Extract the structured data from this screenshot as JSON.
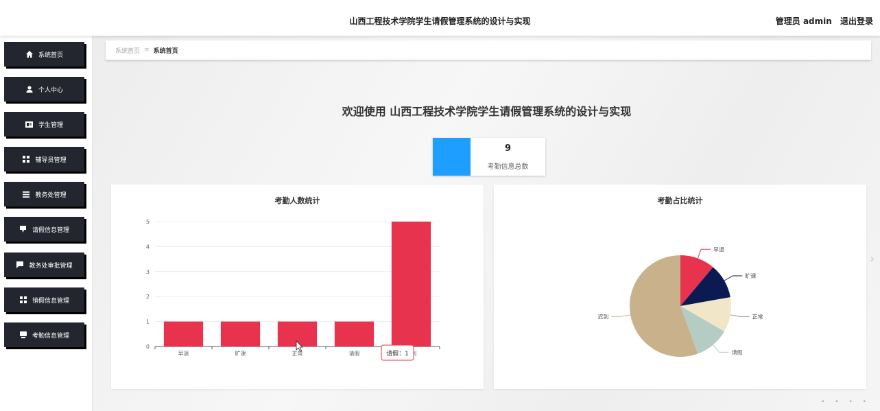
{
  "header": {
    "title": "山西工程技术学院学生请假管理系统的设计与实现",
    "user": "管理员 admin",
    "logout": "退出登录"
  },
  "sidebar": {
    "items": [
      {
        "label": "系统首页",
        "icon": "home-icon"
      },
      {
        "label": "个人中心",
        "icon": "user-icon"
      },
      {
        "label": "学生管理",
        "icon": "id-card-icon"
      },
      {
        "label": "辅导员管理",
        "icon": "grid-icon"
      },
      {
        "label": "教务处管理",
        "icon": "list-icon"
      },
      {
        "label": "请假信息管理",
        "icon": "clipboard-icon"
      },
      {
        "label": "教务处审批管理",
        "icon": "message-icon"
      },
      {
        "label": "销假信息管理",
        "icon": "grid-icon"
      },
      {
        "label": "考勤信息管理",
        "icon": "document-icon"
      }
    ]
  },
  "breadcrumb": {
    "home": "系统首页",
    "sep": "≡",
    "current": "系统首页"
  },
  "welcome": "欢迎使用 山西工程技术学院学生请假管理系统的设计与实现",
  "stat": {
    "value": "9",
    "label": "考勤信息总数",
    "color": "#1e9fff"
  },
  "tooltip": {
    "text": "请假：1"
  },
  "chart_data": [
    {
      "type": "bar",
      "title": "考勤人数统计",
      "categories": [
        "早退",
        "旷课",
        "正常",
        "请假",
        "迟到"
      ],
      "values": [
        1,
        1,
        1,
        1,
        5
      ],
      "ylim": [
        0,
        5
      ],
      "yticks": [
        0,
        1,
        2,
        3,
        4,
        5
      ],
      "color": "#e8334e",
      "grid": true
    },
    {
      "type": "pie",
      "title": "考勤占比统计",
      "labels": [
        "早退",
        "旷课",
        "正常",
        "请假",
        "迟到"
      ],
      "values": [
        1,
        1,
        1,
        1,
        5
      ],
      "colors": [
        "#e8334e",
        "#0b1a52",
        "#f2e6c9",
        "#b4ccc4",
        "#c9b18c"
      ]
    }
  ]
}
